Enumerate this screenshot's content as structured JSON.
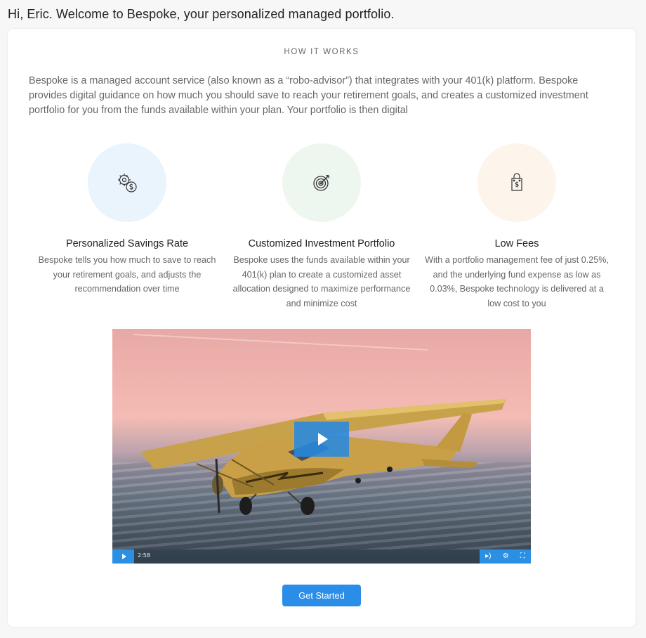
{
  "greeting": "Hi, Eric. Welcome to Bespoke, your personalized managed portfolio.",
  "section": {
    "eyebrow": "HOW IT WORKS",
    "intro": "Bespoke is a managed account service (also known as a “robo-advisor”) that integrates with your 401(k) platform. Bespoke provides digital guidance on how much you should save to reach your retirement goals, and creates a customized investment portfolio for you from the funds available within your plan. Your portfolio is then digital"
  },
  "features": [
    {
      "icon": "gear-dollar-icon",
      "title": "Personalized Savings Rate",
      "description": "Bespoke tells you how much to save to reach your retirement goals, and adjusts the recommendation over time",
      "color": "#eaf4fd"
    },
    {
      "icon": "target-icon",
      "title": "Customized Investment Portfolio",
      "description": "Bespoke uses the funds available within your 401(k) plan to create a customized asset allocation designed to maximize performance and minimize cost",
      "color": "#eef7ef"
    },
    {
      "icon": "price-tag-icon",
      "title": "Low Fees",
      "description": "With a portfolio management fee of just 0.25%, and the underlying fund expense as low as 0.03%, Bespoke technology is delivered at a low cost to you",
      "color": "#fdf4ec"
    }
  ],
  "video": {
    "duration": "2:58",
    "controls": [
      "play-icon",
      "volume-icon",
      "settings-icon",
      "fullscreen-icon"
    ]
  },
  "cta": {
    "label": "Get Started",
    "color": "#2a8de8"
  }
}
